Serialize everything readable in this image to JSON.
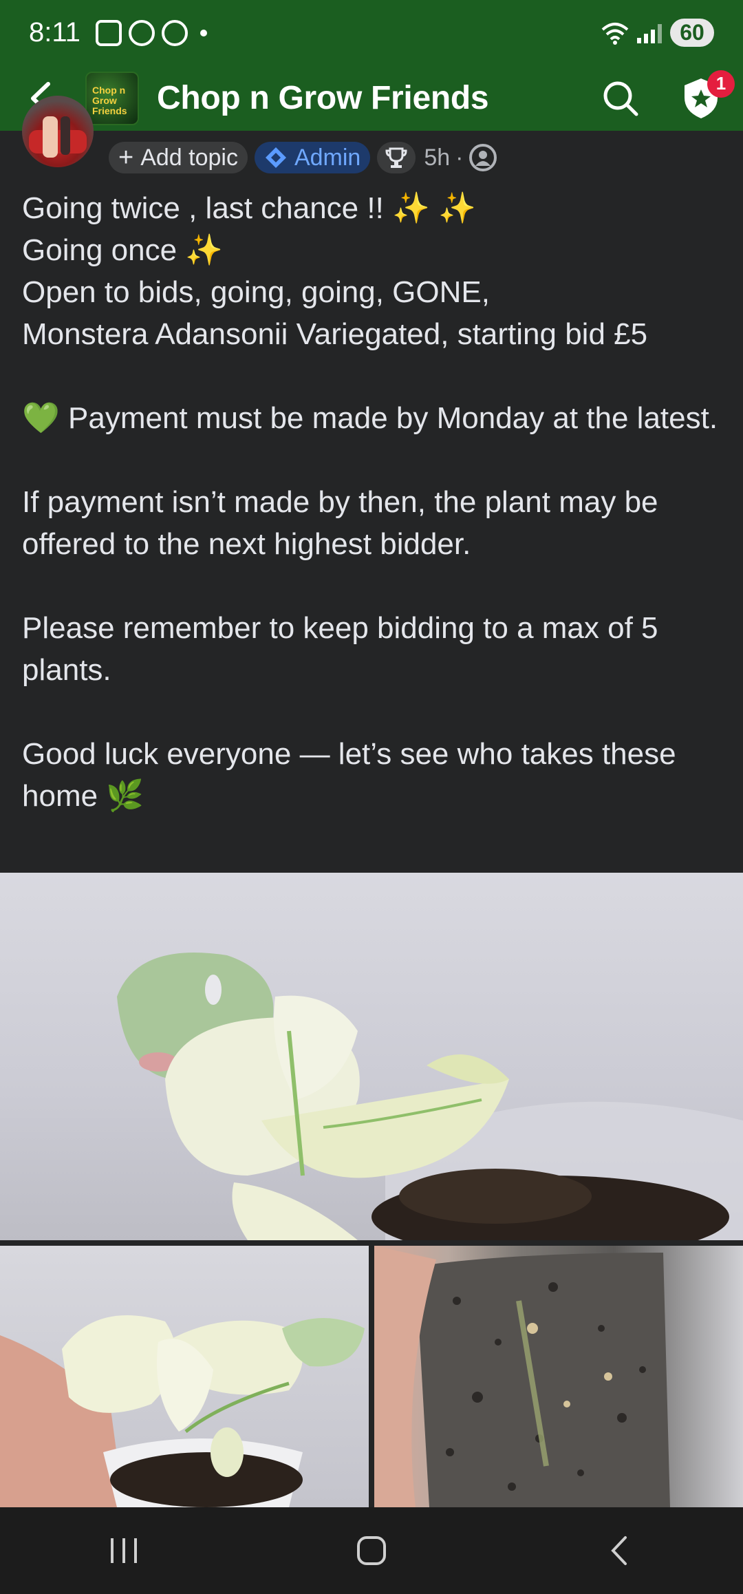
{
  "status_bar": {
    "time": "8:11",
    "battery": "60",
    "left_icons": [
      "screenshot-icon",
      "threads-icon",
      "messenger-icon"
    ],
    "right_icons": [
      "wifi-icon",
      "signal-icon"
    ]
  },
  "header": {
    "back_icon": "back-arrow-icon",
    "group_logo_text": "Chop n Grow Friends",
    "title": "Chop n Grow Friends",
    "search_icon": "search-icon",
    "shield_icon": "admin-shield-icon",
    "notification_count": "1",
    "colors": {
      "bar": "#1b5e20",
      "badge": "#e41e3f"
    }
  },
  "post": {
    "add_topic_label": "Add topic",
    "admin_label": "Admin",
    "time": "5h",
    "separator": "·",
    "lines": [
      "Going twice , last chance !! ✨ ✨",
      "Going once ✨",
      "Open to bids, going, going, GONE,",
      "Monstera Adansonii Variegated, starting bid £5",
      "",
      "💚 Payment must be made by Monday at the latest.",
      "",
      "If payment isn’t made by then, the plant may be offered to the next highest bidder.",
      "",
      "Please remember to keep bidding to a max of 5 plants.",
      "",
      "Good luck everyone — let’s see who takes these home 🌿"
    ]
  },
  "nav": {
    "recents_icon": "recent-apps-icon",
    "home_icon": "home-icon",
    "back_icon": "back-icon"
  }
}
